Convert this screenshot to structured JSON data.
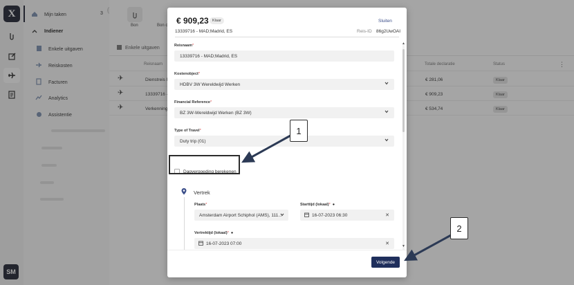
{
  "rail": {
    "logo_text": "X",
    "avatar_text": "SM"
  },
  "sidebar": {
    "mijn_taken": "Mijn taken",
    "mijn_taken_count": "3",
    "indiener": "Indiener",
    "items": [
      {
        "label": "Enkele uitgaven",
        "icon": "receipt-icon"
      },
      {
        "label": "Reiskosten",
        "icon": "plane-icon"
      },
      {
        "label": "Facturen",
        "icon": "invoice-icon"
      },
      {
        "label": "Analytics",
        "icon": "chart-icon"
      },
      {
        "label": "Assistentie",
        "icon": "help-icon"
      }
    ]
  },
  "main": {
    "doc_tiles": [
      "Bon",
      "Bon o"
    ],
    "tab_label": "Enkele uitgaven",
    "columns": {
      "reisnaam": "Reisnaam",
      "totale_declaratie": "Totale declaratie",
      "status": "Status"
    },
    "rows": [
      {
        "reisnaam": "Dienstreis F",
        "total": "€ 281,06",
        "status": "Klaar"
      },
      {
        "reisnaam": "13339716 -",
        "total": "€ 909,23",
        "status": "Klaar"
      },
      {
        "reisnaam": "Verkenning",
        "total": "€ 534,74",
        "status": "Klaar"
      }
    ]
  },
  "modal": {
    "amount": "€ 909,23",
    "status": "Klaar",
    "close_label": "Sluiten",
    "subtitle": "13339716 - MAD;Madrid, ES",
    "reis_id_label": "Reis-ID",
    "reis_id_value": "86g2UwOAI",
    "fields": {
      "reisnaam": {
        "label": "Reisnaam",
        "value": "13339716 - MAD;Madrid, ES"
      },
      "kostenobject": {
        "label": "Kostenobject",
        "value": "HDBV 3W Wereldwijd Werken"
      },
      "financial_reference": {
        "label": "Financial Reference",
        "value": "BZ 3W-Wereldwijd Werken (BZ 3W)"
      },
      "type_of_travel": {
        "label": "Type of Travel",
        "value": "Duty trip (01)"
      }
    },
    "checkbox_label": "Dagvergoeding berekenen",
    "vertrek": {
      "heading": "Vertrek",
      "plaats_label": "Plaats",
      "plaats_value": "Amsterdam Airport Schiphol (AMS), 111...",
      "starttijd_label": "Starttijd (lokaal)",
      "starttijd_value": "16-07-2023 06:30",
      "vertrektijd_label": "Vertrektijd (lokaal)",
      "vertrektijd_value": "16-07-2023 07:00"
    },
    "next_label": "Volgende"
  },
  "annotations": {
    "callout_1": "1",
    "callout_2": "2"
  },
  "icons": {
    "required_marker": "*",
    "info": "info-icon",
    "calendar": "calendar-icon",
    "clear": "clear-icon"
  },
  "colors": {
    "navy": "#1f2f5c",
    "overlay": "#282828",
    "link": "#3c4f8a"
  }
}
